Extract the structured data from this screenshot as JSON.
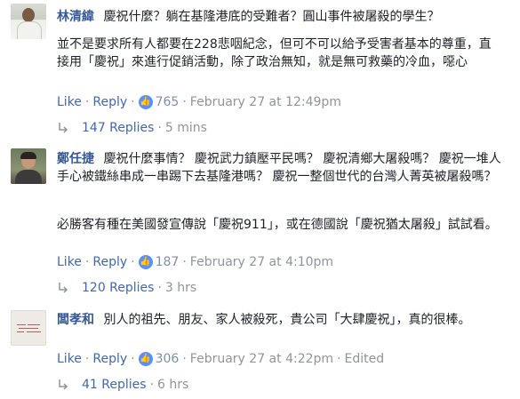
{
  "comments": [
    {
      "author": "林清緯",
      "first_line": "慶祝什麼？躺在基隆港底的受難者？圓山事件被屠殺的學生？",
      "body": "並不是要求所有人都要在228悲咽紀念，但可不可以給予受害者基本的尊重，直接用「慶祝」來進行促銷活動，除了政治無知，就是無可救藥的冷血，噁心",
      "like_label": "Like",
      "reply_label": "Reply",
      "likes": "765",
      "timestamp": "February 27 at 12:49pm",
      "edited": "",
      "replies_label": "147 Replies",
      "replies_time": "5 mins"
    },
    {
      "author": "鄭任捷",
      "first_line": "慶祝什麼事情？ 慶祝武力鎮壓平民嗎？ 慶祝清鄉大屠殺嗎？ 慶祝一堆人手心被鐵絲串成一串踢下去基隆港嗎？ 慶祝一整個世代的台灣人菁英被屠殺嗎？",
      "body": "必勝客有種在美國發宣傳說「慶祝911」，或在德國說「慶祝猶太屠殺」試試看。",
      "like_label": "Like",
      "reply_label": "Reply",
      "likes": "187",
      "timestamp": "February 27 at 4:10pm",
      "edited": "",
      "replies_label": "120 Replies",
      "replies_time": "3 hrs"
    },
    {
      "author": "闆孝和",
      "first_line": "別人的祖先、朋友、家人被殺死，貴公司「大肆慶祝」，真的很棒。",
      "body": "",
      "like_label": "Like",
      "reply_label": "Reply",
      "likes": "306",
      "timestamp": "February 27 at 4:22pm",
      "edited": "Edited",
      "replies_label": "41 Replies",
      "replies_time": "6 hrs"
    }
  ],
  "colors": {
    "link": "#4267b2",
    "author": "#365899",
    "meta": "#90949c",
    "like_badge": "#5890ff"
  },
  "icons": {
    "like": "thumbs-up-icon",
    "reply_thread": "reply-arrow-icon"
  }
}
